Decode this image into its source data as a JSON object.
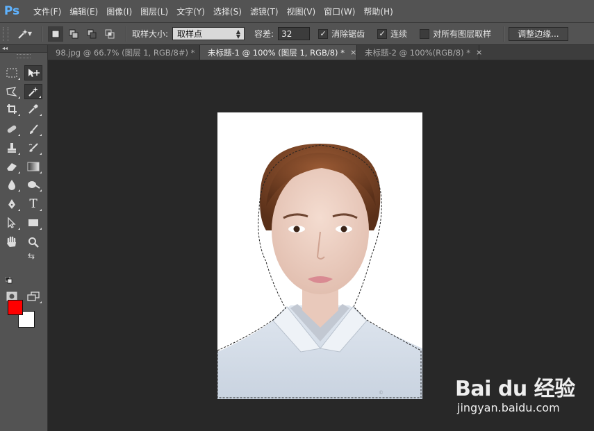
{
  "app": {
    "logo": "Ps"
  },
  "menu": [
    "文件(F)",
    "编辑(E)",
    "图像(I)",
    "图层(L)",
    "文字(Y)",
    "选择(S)",
    "滤镜(T)",
    "视图(V)",
    "窗口(W)",
    "帮助(H)"
  ],
  "options": {
    "tool_icon": "magic-wand-icon",
    "sample_size_label": "取样大小:",
    "sample_size_value": "取样点",
    "tolerance_label": "容差:",
    "tolerance_value": "32",
    "antialias_label": "消除锯齿",
    "antialias_checked": true,
    "contiguous_label": "连续",
    "contiguous_checked": true,
    "sample_all_label": "对所有图层取样",
    "sample_all_checked": false,
    "refine_edge_label": "调整边缘..."
  },
  "tabs": [
    {
      "label": "98.jpg @ 66.7% (图层 1, RGB/8#) *",
      "active": false
    },
    {
      "label": "未标题-1 @ 100% (图层 1, RGB/8) *",
      "active": true
    },
    {
      "label": "未标题-2 @ 100%(RGB/8) *",
      "active": false
    }
  ],
  "tab_close": "×",
  "toolbox": {
    "collapse": "◂◂",
    "tools": [
      "rect-marquee-icon",
      "move-icon",
      "lasso-icon",
      "magic-wand-icon",
      "crop-icon",
      "eyedropper-icon",
      "healing-brush-icon",
      "brush-icon",
      "clone-stamp-icon",
      "history-brush-icon",
      "eraser-icon",
      "gradient-icon",
      "blur-icon",
      "dodge-icon",
      "pen-icon",
      "type-icon",
      "path-select-icon",
      "rectangle-shape-icon",
      "hand-icon",
      "zoom-icon"
    ],
    "type_tool_glyph": "T"
  },
  "colors": {
    "foreground": "#ff0000",
    "background": "#ffffff",
    "accent": "#5fb3ff"
  },
  "watermark": {
    "logo": "Bai du 经验",
    "url": "jingyan.baidu.com"
  }
}
